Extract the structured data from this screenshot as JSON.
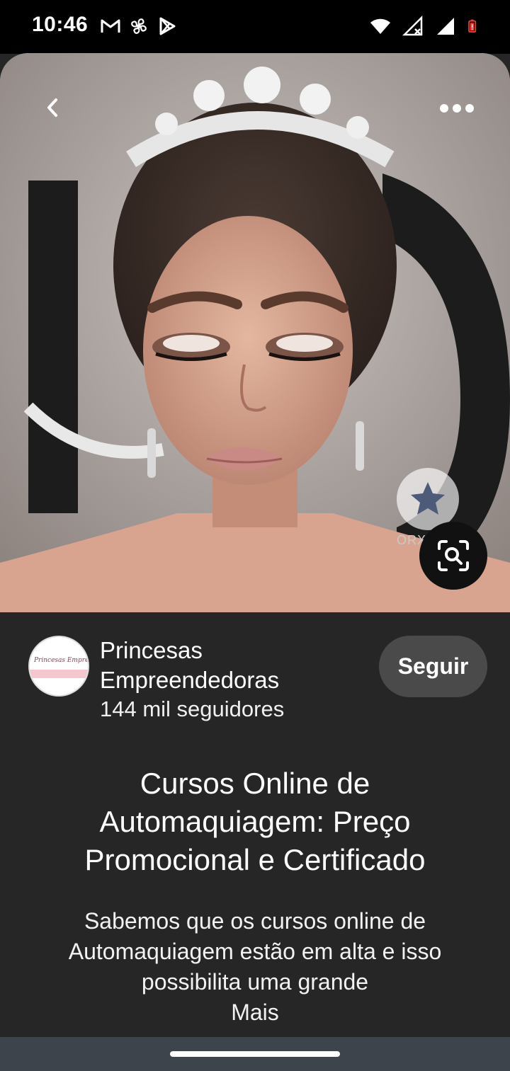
{
  "status_bar": {
    "time": "10:46",
    "left_icons": [
      "gmail-icon",
      "fan-icon",
      "play-store-icon"
    ],
    "right_icons": [
      "wifi-icon",
      "signal-off-icon",
      "signal-icon",
      "battery-low-icon"
    ],
    "battery_color": "#ff3b30"
  },
  "hero": {
    "description_icons": [
      "back-arrow-icon",
      "more-dots-icon",
      "visual-search-icon"
    ],
    "watermark_text": "ORXD"
  },
  "creator": {
    "name": "Princesas Empreendedoras",
    "followers": "144 mil seguidores",
    "avatar_text": "Princesas Empreendedoras",
    "follow_label": "Seguir"
  },
  "pin": {
    "title": "Cursos Online de Automaquiagem: Preço Promocional e Certificado",
    "description": "Sabemos que os cursos online de Automaquiagem estão  em alta e isso possibilita uma grande",
    "more_label": "Mais"
  },
  "colors": {
    "background": "#262626",
    "follow_button": "#4a4a4a",
    "nav_bar": "#3e444b"
  }
}
